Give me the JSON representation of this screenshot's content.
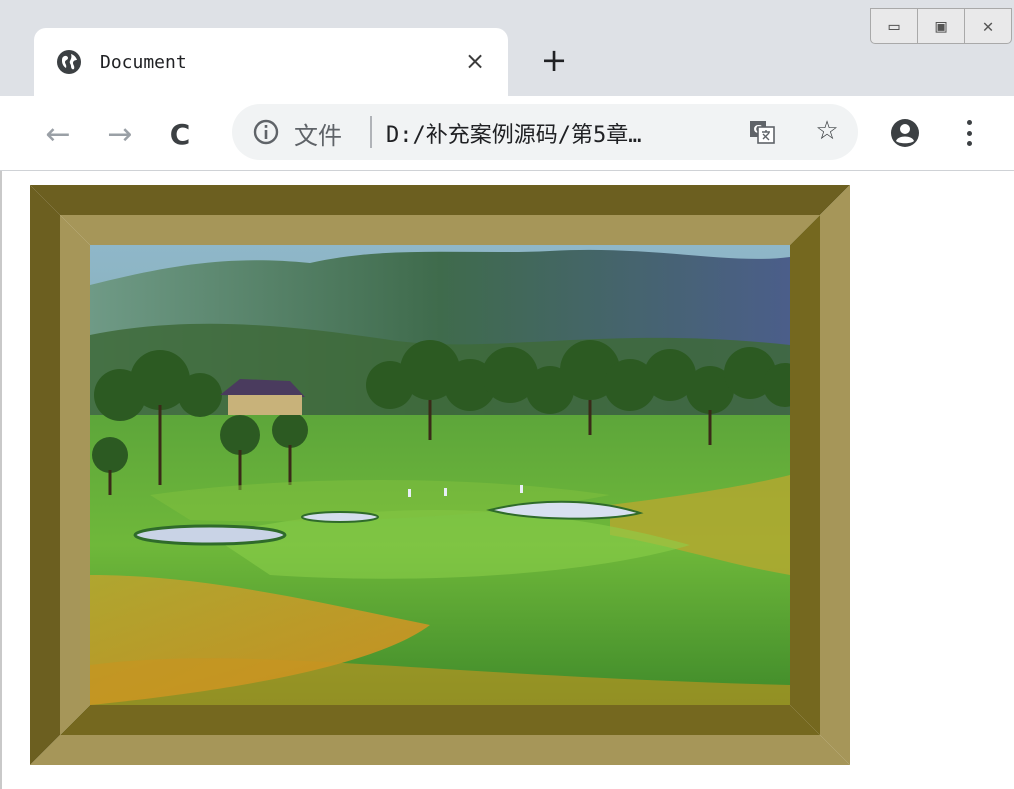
{
  "window": {
    "controls": {
      "minimize": "▭",
      "maximize": "▣",
      "close": "✕"
    }
  },
  "tab": {
    "title": "Document",
    "favicon": "globe-icon",
    "close_label": "×"
  },
  "toolbar": {
    "new_tab_label": "+",
    "back": "←",
    "forward": "→",
    "reload": "C",
    "origin_label": "文件",
    "url": "D:/补充案例源码/第5章…",
    "bookmark": "☆"
  },
  "content": {
    "image": "golf-course-landscape",
    "frame_colors": {
      "outer_dark": "#6b5f22",
      "inner_light": "#a3955a",
      "bevel_dark": "#75681f"
    }
  }
}
